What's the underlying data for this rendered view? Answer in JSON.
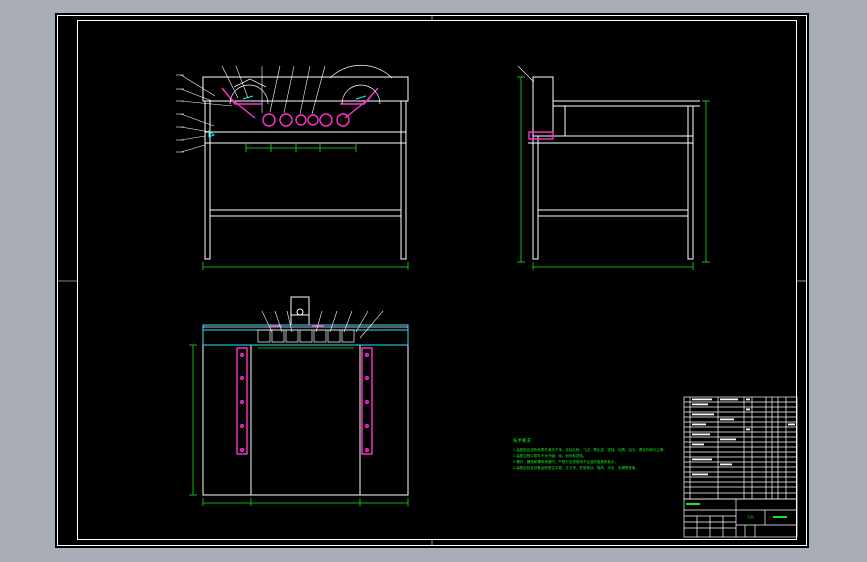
{
  "notes": {
    "heading": "技术要求",
    "lines": [
      "1.装配前应将所有零件清洗干净，去除毛刺、飞边、氧化皮、锈蚀、切屑、油污、着色剂和灰尘等。",
      "2.装配过程中零件不允许磕、碰、划伤和锈蚀。",
      "3.螺钉、螺栓和螺母紧固时，严禁打击或使用不合适的旋具和扳手。",
      "4.装配后检查设备运转是否平稳，无卡滞、异常振动、噪声、冲击、渗漏等现象。"
    ]
  },
  "title_block": {
    "text": "刀片"
  },
  "colors": {
    "background": "#000000",
    "frame": "#ffffff",
    "dimension": "#19e619",
    "highlight": "#ff33cc",
    "accent": "#33e0ff",
    "app_bg": "#a9aeb6"
  }
}
